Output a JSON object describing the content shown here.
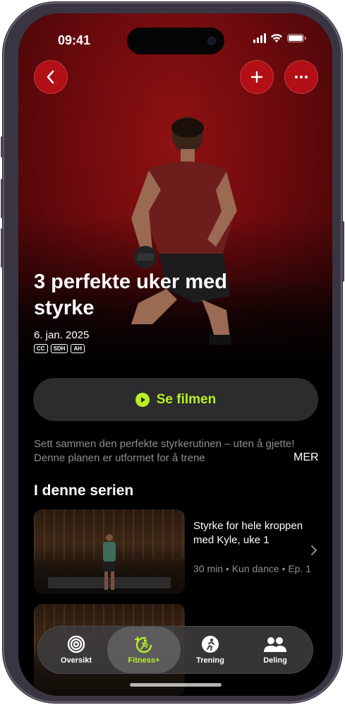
{
  "status": {
    "time": "09:41"
  },
  "hero": {
    "title": "3 perfekte uker med styrke",
    "date": "6. jan. 2025",
    "badges": [
      "CC",
      "SDH",
      "AH"
    ]
  },
  "nav": {
    "back_icon": "chevron-left-icon",
    "add_icon": "plus-icon",
    "more_icon": "ellipsis-icon"
  },
  "play_button": {
    "label": "Se filmen",
    "icon": "play-circle-icon",
    "color": "#b8f024"
  },
  "description": {
    "text": "Sett sammen den perfekte styrkerutinen – uten å gjette! Denne planen er utformet for å trene",
    "more_label": "MER"
  },
  "series": {
    "section_title": "I denne serien",
    "episodes": [
      {
        "title": "Styrke for hele kroppen med Kyle, uke 1",
        "meta": "30 min • Kun dance • Ep. 1"
      }
    ]
  },
  "tabbar": {
    "tabs": [
      {
        "label": "Oversikt",
        "icon": "summary-rings-icon",
        "active": false
      },
      {
        "label": "Fitness+",
        "icon": "fitness-plus-icon",
        "active": true
      },
      {
        "label": "Trening",
        "icon": "running-person-icon",
        "active": false
      },
      {
        "label": "Deling",
        "icon": "people-icon",
        "active": false
      }
    ]
  },
  "colors": {
    "accent": "#b8f024",
    "hero_red": "#8f1212",
    "button_red": "#b20f16"
  }
}
